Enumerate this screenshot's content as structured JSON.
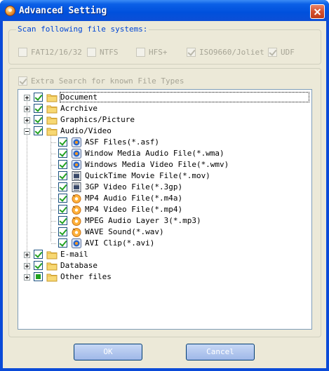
{
  "window": {
    "title": "Advanced Setting"
  },
  "filesystems": {
    "title": "Scan following file systems:",
    "items": [
      {
        "label": "FAT12/16/32",
        "checked": false
      },
      {
        "label": "NTFS",
        "checked": false
      },
      {
        "label": "HFS+",
        "checked": false
      },
      {
        "label": "ISO9660/Joliet",
        "checked": true
      },
      {
        "label": "UDF",
        "checked": true
      }
    ]
  },
  "extra_search": {
    "label": "Extra Search for known File Types",
    "checked": true
  },
  "tree": [
    {
      "label": "Document",
      "type": "folder",
      "state": "checked",
      "expander": "plus",
      "depth": 0
    },
    {
      "label": "Acrchive",
      "type": "folder",
      "state": "checked",
      "expander": "plus",
      "depth": 0
    },
    {
      "label": "Graphics/Picture",
      "type": "folder",
      "state": "checked",
      "expander": "plus",
      "depth": 0
    },
    {
      "label": "Audio/Video",
      "type": "folder",
      "state": "checked",
      "expander": "minus",
      "depth": 0
    },
    {
      "label": "ASF Files(*.asf)",
      "type": "media-player-icon",
      "state": "checked",
      "depth": 1
    },
    {
      "label": "Window Media Audio File(*.wma)",
      "type": "media-player-icon",
      "state": "checked",
      "depth": 1
    },
    {
      "label": "Windows Media Video File(*.wmv)",
      "type": "media-player-icon",
      "state": "checked",
      "depth": 1
    },
    {
      "label": "QuickTime Movie File(*.mov)",
      "type": "video-file-icon",
      "state": "checked",
      "depth": 1
    },
    {
      "label": "3GP Video File(*.3gp)",
      "type": "video-file-icon",
      "state": "checked",
      "depth": 1
    },
    {
      "label": "MP4 Audio File(*.m4a)",
      "type": "audio-file-icon",
      "state": "checked",
      "depth": 1
    },
    {
      "label": "MP4 Video File(*.mp4)",
      "type": "audio-file-icon",
      "state": "checked",
      "depth": 1
    },
    {
      "label": "MPEG Audio Layer 3(*.mp3)",
      "type": "audio-file-icon",
      "state": "checked",
      "depth": 1
    },
    {
      "label": "WAVE Sound(*.wav)",
      "type": "audio-file-icon",
      "state": "checked",
      "depth": 1
    },
    {
      "label": "AVI Clip(*.avi)",
      "type": "media-player-icon",
      "state": "checked",
      "depth": 1
    },
    {
      "label": "E-mail",
      "type": "folder",
      "state": "checked",
      "expander": "plus",
      "depth": 0
    },
    {
      "label": "Database",
      "type": "folder",
      "state": "checked",
      "expander": "plus",
      "depth": 0
    },
    {
      "label": "Other files",
      "type": "folder",
      "state": "partial",
      "expander": "plus",
      "depth": 0
    }
  ],
  "buttons": {
    "ok": "OK",
    "cancel": "Cancel"
  },
  "colors": {
    "accent": "#0046d5",
    "check": "#21a121",
    "title_bar": "#0050dc",
    "dialog_bg": "#ece9d8"
  }
}
